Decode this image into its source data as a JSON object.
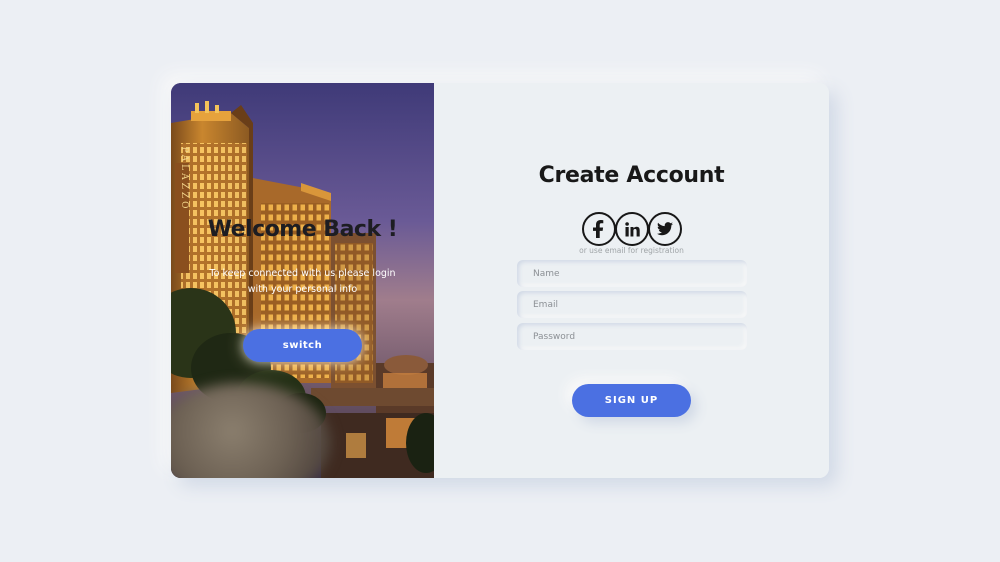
{
  "colors": {
    "background": "#eceff4",
    "accent": "#4b70e2",
    "heading": "#181818"
  },
  "left_panel": {
    "title": "Welcome Back !",
    "text": "To keep connected with us please login with your personal info",
    "button_label": "switch",
    "sign_text": "PALAZZO"
  },
  "form": {
    "title": "Create Account",
    "social": [
      {
        "name": "facebook-icon"
      },
      {
        "name": "linkedin-icon"
      },
      {
        "name": "twitter-icon"
      }
    ],
    "hint": "or use email for registration",
    "name_placeholder": "Name",
    "email_placeholder": "Email",
    "password_placeholder": "Password",
    "submit_label": "SIGN UP"
  }
}
